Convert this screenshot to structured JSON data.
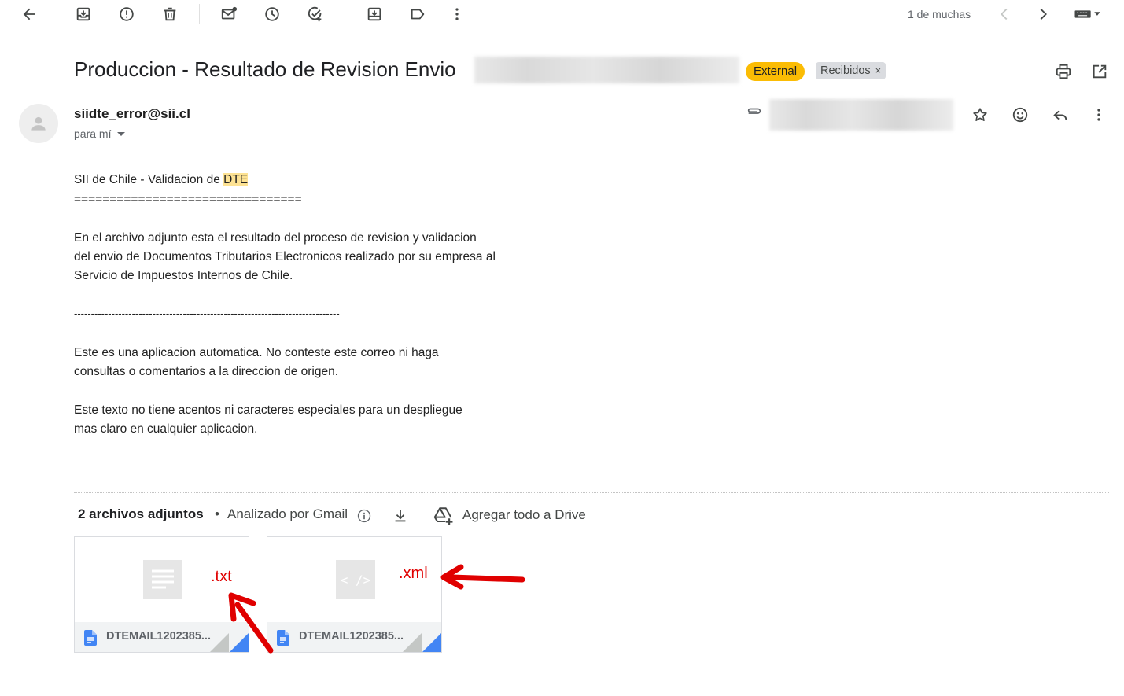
{
  "toolbar": {
    "counter": "1 de muchas",
    "icons": [
      "back-arrow-icon",
      "archive-icon",
      "report-spam-icon",
      "delete-icon",
      "mark-unread-icon",
      "snooze-icon",
      "add-to-tasks-icon",
      "move-to-icon",
      "label-icon",
      "more-vert-icon",
      "chevron-left-icon",
      "chevron-right-icon",
      "keyboard-icon"
    ]
  },
  "email": {
    "subject": "Produccion - Resultado de Revision Envio",
    "tags": {
      "external": "External",
      "inbox": "Recibidos",
      "inbox_remove": "×"
    },
    "sender": "siidte_error@sii.cl",
    "recipient": "para mí",
    "body": [
      {
        "pre": "SII de Chile - Validacion de ",
        "highlight": "DTE"
      },
      {
        "text": "================================"
      },
      {
        "text": "En el archivo adjunto esta el resultado del proceso de revision y validacion"
      },
      {
        "text": "del envio de Documentos Tributarios Electronicos realizado por su empresa al"
      },
      {
        "text": "Servicio de Impuestos Internos de Chile."
      },
      {
        "text": "------------------------------------------------------------------------------"
      },
      {
        "text": "Este es una aplicacion automatica. No conteste este correo ni haga"
      },
      {
        "text": "consultas o comentarios a la direccion de origen."
      },
      {
        "text": "Este texto no tiene acentos ni caracteres especiales para un despliegue"
      },
      {
        "text": "mas claro en cualquier aplicacion."
      }
    ]
  },
  "attachments": {
    "count_label": "2 archivos adjuntos",
    "dot": "•",
    "scanned_label": "Analizado por Gmail",
    "drive_label": "Agregar todo a Drive",
    "files": [
      {
        "name": "DTEMAIL1202385...",
        "annotation": ".txt"
      },
      {
        "name": "DTEMAIL1202385...",
        "annotation": ".xml"
      }
    ],
    "xml_thumb_glyph": "< />"
  },
  "colors": {
    "external_tag": "#fbbc04",
    "annotation_red": "#e00000",
    "doc_icon_blue": "#4285f4",
    "highlight": "#fde293"
  }
}
